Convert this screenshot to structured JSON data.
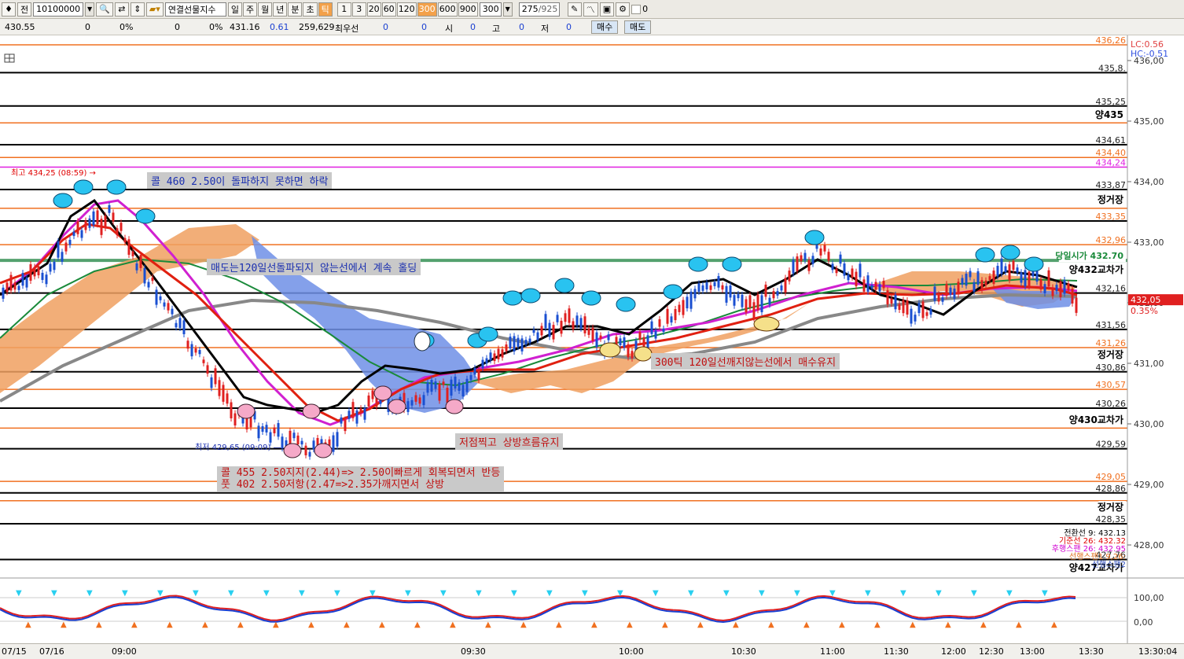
{
  "toolbar": {
    "mode_label": "전",
    "code_value": "10100000",
    "instrument": "연결선물지수",
    "periods": [
      "일",
      "주",
      "월",
      "년",
      "분",
      "초",
      "틱"
    ],
    "tick_options": [
      "1",
      "3",
      "20",
      "60",
      "120",
      "300",
      "600",
      "900"
    ],
    "selected_tick": "300",
    "tick_input": "300",
    "page_counter": "275",
    "page_total": "/925",
    "checkbox_value": "0"
  },
  "quote": {
    "price": "430.55",
    "v1": "0",
    "p1": "0%",
    "v2": "0",
    "p2": "0%",
    "last": "431.16",
    "change": "0.61",
    "volume": "259,629",
    "label_best": "최우선",
    "best1": "0",
    "best2": "0",
    "label_open": "시",
    "open": "0",
    "label_high": "고",
    "high": "0",
    "label_low": "저",
    "low": "0",
    "buy_label": "매수",
    "sell_label": "매도"
  },
  "chart_data": {
    "type": "line",
    "y_axis": [
      "436,00",
      "435,00",
      "434,00",
      "433,00",
      "432,00",
      "431,00",
      "430,00",
      "429,00",
      "428,00"
    ],
    "level_labels": [
      "436,26",
      "435,8.",
      "435,25",
      "434,61",
      "434,40",
      "434,24",
      "433,87",
      "433,35",
      "432,96",
      "432,16",
      "431,56",
      "431,26",
      "430,86",
      "430,57",
      "430,26",
      "429,59",
      "429,05",
      "428,86",
      "428,35",
      "427,76"
    ],
    "right_tags": [
      "양435",
      "정거장",
      "당일시가 432.70",
      "양432교차가",
      "정거장",
      "양430교차가",
      "정거장",
      "양427교차가"
    ],
    "current_price": "432,05",
    "current_pct": "0.35%",
    "lc": "LC:0.56",
    "hc": "HC:-0.51",
    "legend": [
      {
        "name": "전환선 9: 432.13",
        "color": "#000000"
      },
      {
        "name": "기준선 26: 432.32",
        "color": "#e00000"
      },
      {
        "name": "후행스팬 26: 432.95",
        "color": "#d000d0"
      },
      {
        "name": "선행스팬1 9,26: ",
        "color": "#e07020"
      },
      {
        "name": "선행스팬2",
        "color": "#3050c0"
      }
    ],
    "high_label": "최고 434,25 (08:59)",
    "low_label": "최저 429,65 (09:09)",
    "x_labels": [
      "07/15",
      "07/16",
      "09:00",
      "09:30",
      "10:00",
      "10:30",
      "11:00",
      "11:30",
      "12:00",
      "12:30",
      "13:00",
      "13:30",
      "13:30:04"
    ],
    "sub_axis": [
      "100,00",
      "0,00"
    ]
  },
  "notes": {
    "n1": "콜 460 2.50이 돌파하지 못하면 하락",
    "n2": "매도는120일선돌파되지 않는선에서 계속 홀딩",
    "n3": "300틱 120일선깨지않는선에서 매수유지",
    "n4": "저점찍고 상방흐름유지",
    "n5a": "콜 455 2.50지지(2.44)=> 2.50이빠르게 회복되면서 반등",
    "n5b": "풋 402 2.50저항(2.47=>2.35가깨지면서 상방"
  },
  "colors": {
    "orange_level": "#f07020",
    "black_level": "#000000",
    "magenta": "#e020e0",
    "green": "#1a8a3a",
    "cloud_orange": "#f0a060",
    "cloud_blue": "#6f8fe6"
  }
}
